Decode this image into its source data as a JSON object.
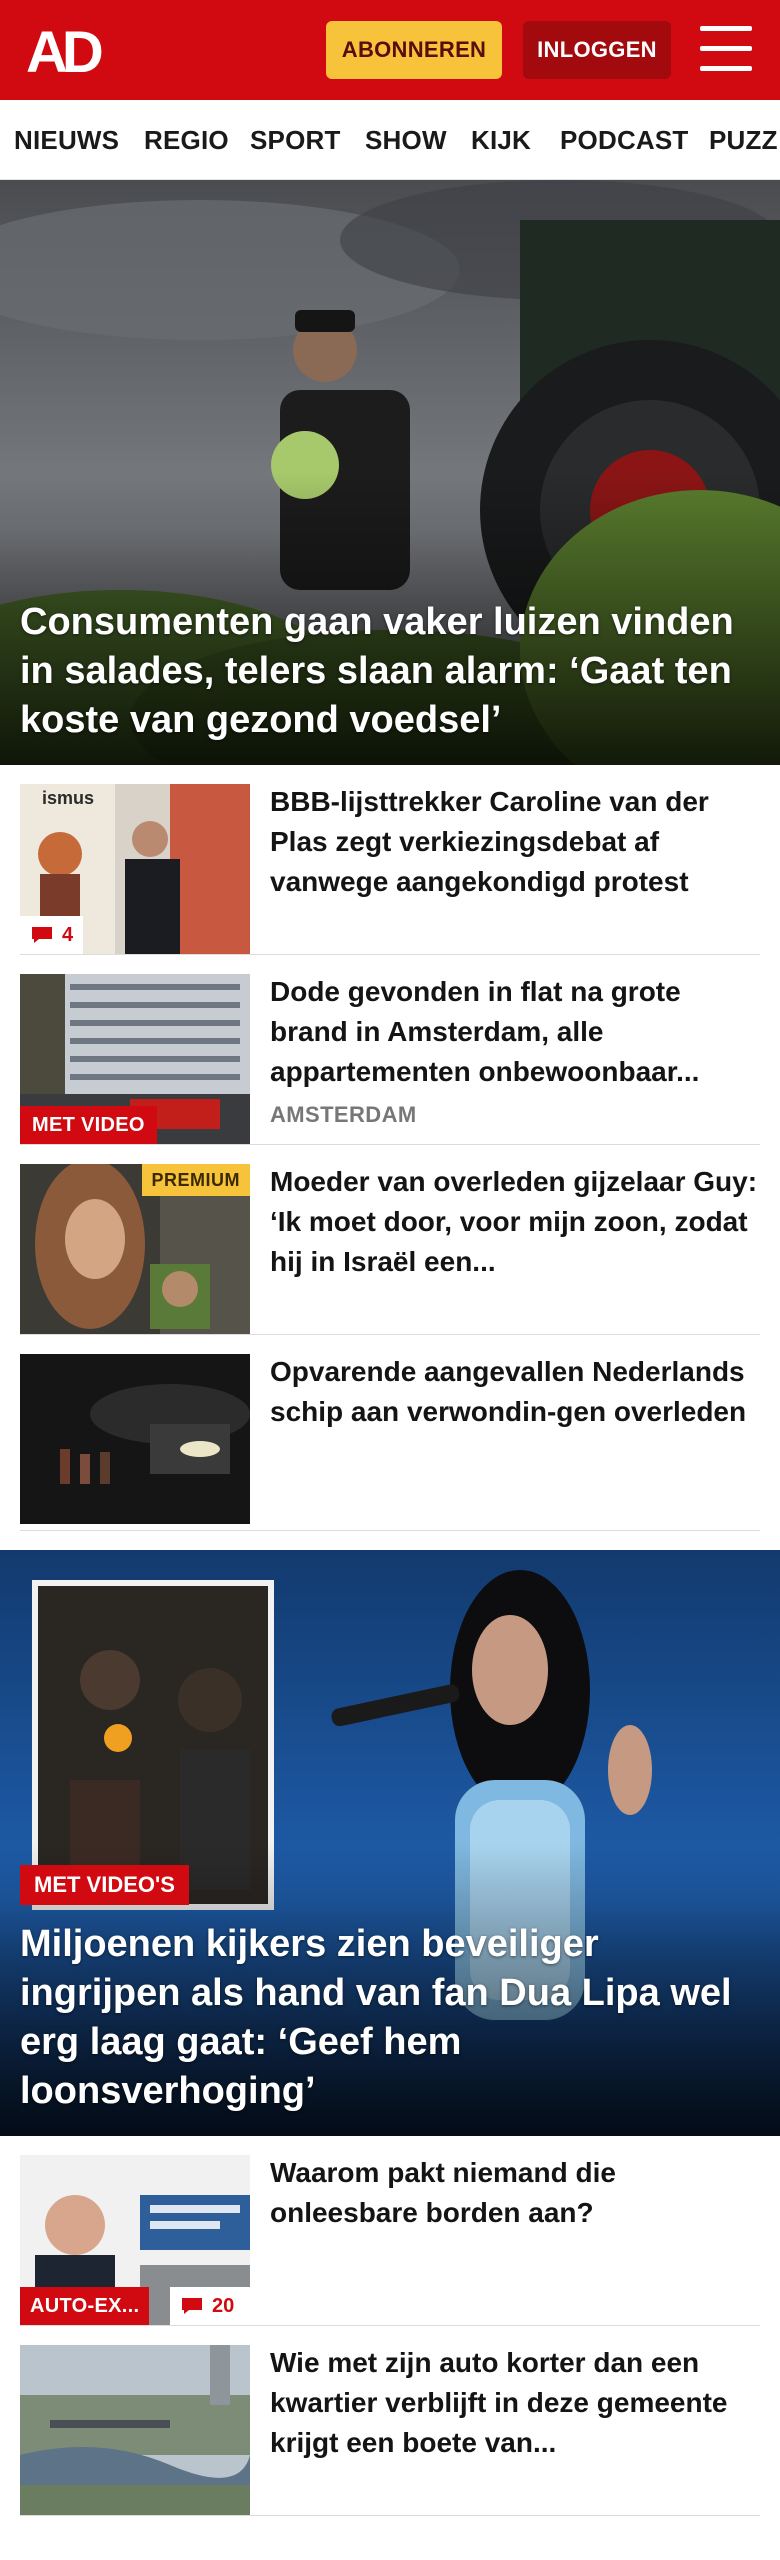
{
  "header": {
    "logo_text": "AD",
    "subscribe_label": "ABONNEREN",
    "login_label": "INLOGGEN",
    "menu_icon": "hamburger-menu-icon",
    "brand_color": "#d10a11",
    "subscribe_color": "#f6c33b"
  },
  "nav": {
    "items": [
      "NIEUWS",
      "REGIO",
      "SPORT",
      "SHOW",
      "KIJK",
      "PODCAST",
      "PUZZ"
    ]
  },
  "hero": {
    "title": "Consumenten gaan vaker luizen vinden in salades, telers slaan alarm: ‘Gaat ten koste van gezond voedsel’"
  },
  "articles": [
    {
      "title": "BBB-lijsttrekker Caroline van der Plas zegt verkiezingsdebat af vanwege aangekondigd protest",
      "comments": "4",
      "thumb_text": "ismus"
    },
    {
      "title": "Dode gevonden in flat na grote brand in Amsterdam, alle appartementen onbewoonbaar...",
      "meta": "AMSTERDAM",
      "badge": "MET VIDEO"
    },
    {
      "title": "Moeder van overleden gijzelaar Guy: ‘Ik moet door, voor mijn zoon, zodat hij in Israël een...",
      "premium": "PREMIUM"
    },
    {
      "title": "Opvarende aangevallen Nederlands schip aan verwondin-gen overleden"
    }
  ],
  "feature": {
    "badge": "MET VIDEO'S",
    "title": "Miljoenen kijkers zien beveiliger ingrijpen als hand van fan Dua Lipa wel erg laag gaat: ‘Geef hem loonsverhoging’"
  },
  "articles2": [
    {
      "title": "Waarom pakt niemand die onleesbare borden aan?",
      "badge": "AUTO-EX...",
      "comments": "20"
    },
    {
      "title": "Wie met zijn auto korter dan een kwartier verblijft in deze gemeente krijgt een boete van..."
    }
  ]
}
